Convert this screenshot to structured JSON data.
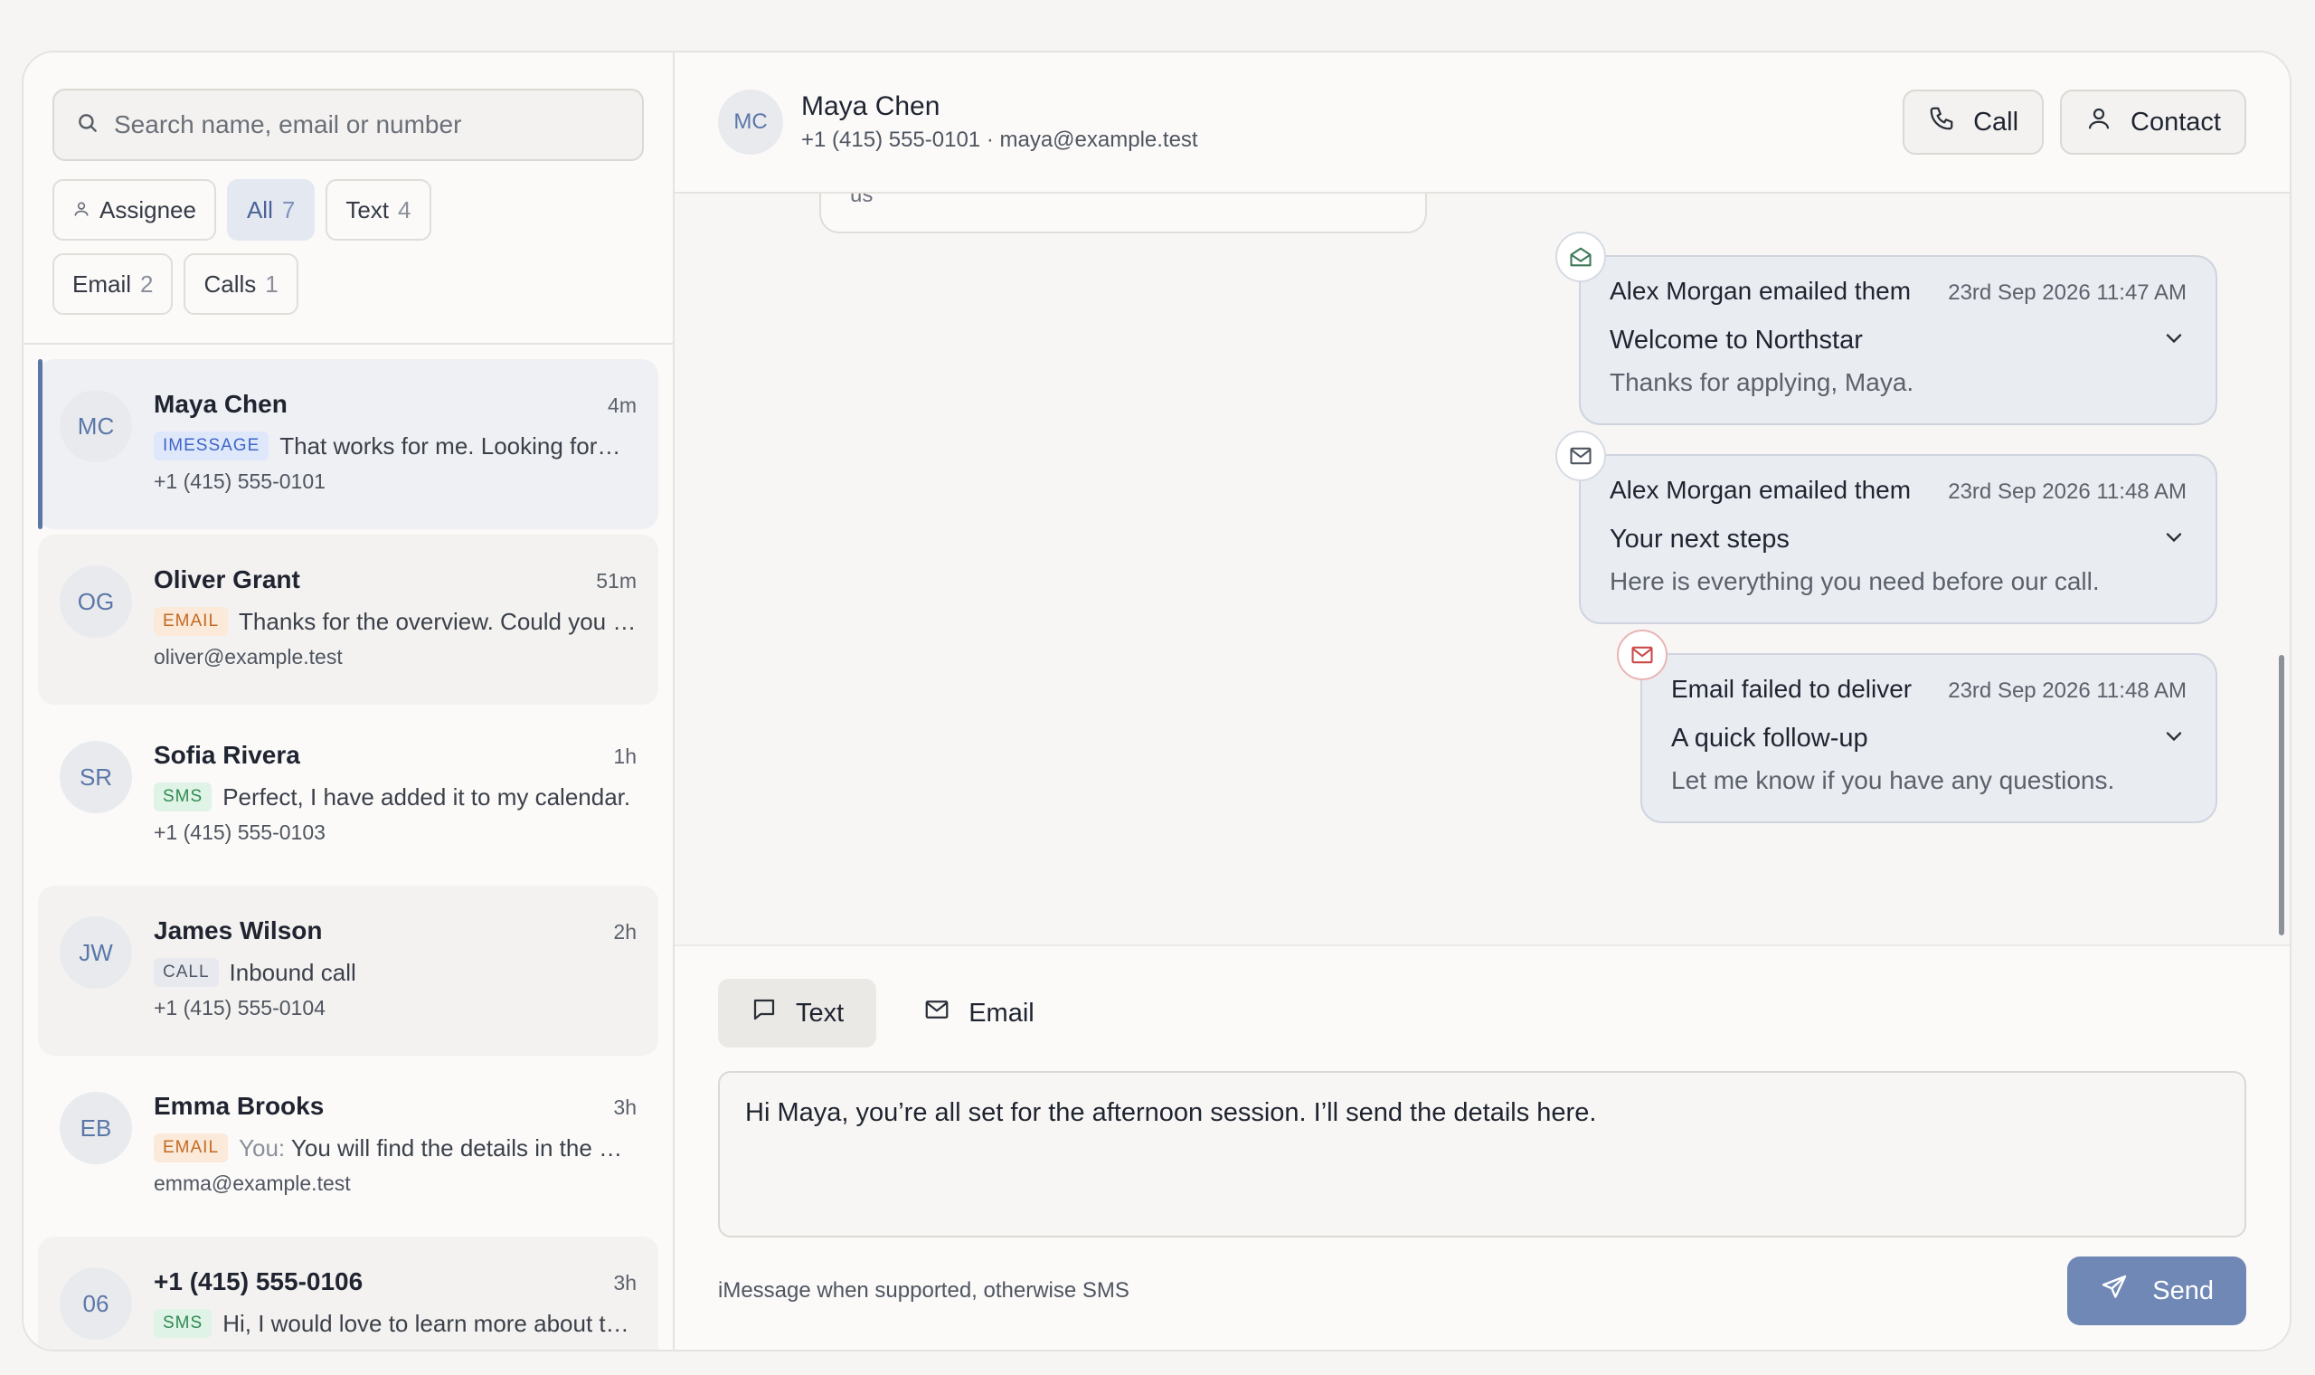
{
  "sidebar": {
    "search_placeholder": "Search name, email or number",
    "filters": [
      {
        "label": "Assignee",
        "count": ""
      },
      {
        "label": "All",
        "count": "7"
      },
      {
        "label": "Text",
        "count": "4"
      },
      {
        "label": "Email",
        "count": "2"
      },
      {
        "label": "Calls",
        "count": "1"
      }
    ],
    "conversations": [
      {
        "initials": "MC",
        "name": "Maya Chen",
        "time": "4m",
        "badge": "IMESSAGE",
        "you": "",
        "preview": "That works for me. Looking forwa…",
        "sub": "+1 (415) 555-0101"
      },
      {
        "initials": "OG",
        "name": "Oliver Grant",
        "time": "51m",
        "badge": "EMAIL",
        "you": "",
        "preview": "Thanks for the overview. Could you s…",
        "sub": "oliver@example.test"
      },
      {
        "initials": "SR",
        "name": "Sofia Rivera",
        "time": "1h",
        "badge": "SMS",
        "you": "",
        "preview": "Perfect, I have added it to my calendar.",
        "sub": "+1 (415) 555-0103"
      },
      {
        "initials": "JW",
        "name": "James Wilson",
        "time": "2h",
        "badge": "CALL",
        "you": "",
        "preview": "Inbound call",
        "sub": "+1 (415) 555-0104"
      },
      {
        "initials": "EB",
        "name": "Emma Brooks",
        "time": "3h",
        "badge": "EMAIL",
        "you": "You:",
        "preview": "You will find the details in the wel…",
        "sub": "emma@example.test"
      },
      {
        "initials": "06",
        "name": "+1 (415) 555-0106",
        "time": "3h",
        "badge": "SMS",
        "you": "",
        "preview": "Hi, I would love to learn more about th…",
        "sub": ""
      }
    ]
  },
  "header": {
    "initials": "MC",
    "name": "Maya Chen",
    "sub": "+1 (415) 555-0101 · maya@example.test",
    "call_label": "Call",
    "contact_label": "Contact"
  },
  "timeline": {
    "prev_fragment": "us",
    "emails": [
      {
        "who": "Alex Morgan emailed them",
        "time": "23rd Sep 2026 11:47 AM",
        "subject": "Welcome to Northstar",
        "preview": "Thanks for applying, Maya.",
        "icon": "mail-open-icon"
      },
      {
        "who": "Alex Morgan emailed them",
        "time": "23rd Sep 2026 11:48 AM",
        "subject": "Your next steps",
        "preview": "Here is everything you need before our call.",
        "icon": "mail-icon"
      },
      {
        "who": "Email failed to deliver",
        "time": "23rd Sep 2026 11:48 AM",
        "subject": "A quick follow-up",
        "preview": "Let me know if you have any questions.",
        "icon": "mail-error-icon"
      }
    ]
  },
  "composer": {
    "tab_text": "Text",
    "tab_email": "Email",
    "message": "Hi Maya, you’re all set for the afternoon session. I’ll send the details here.",
    "hint": "iMessage when supported, otherwise SMS",
    "send_label": "Send"
  },
  "colors": {
    "accent": "#6f88b5",
    "selected_bar": "#5b77a8",
    "imessage_badge": "#3d66c9",
    "email_badge": "#c36a22",
    "sms_badge": "#2f8a52",
    "error": "#c94a4a"
  }
}
